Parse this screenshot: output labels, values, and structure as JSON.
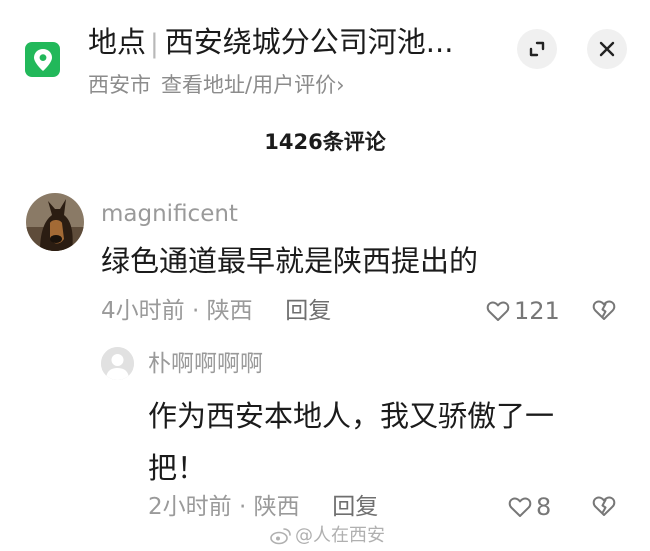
{
  "header": {
    "place_label": "地点",
    "place_name": "西安绕城分公司河池...",
    "city": "西安市",
    "address_link": "查看地址/用户评价",
    "chevron": "›"
  },
  "comment_count": "1426条评论",
  "comments": [
    {
      "username": "magnificent",
      "text": "绿色通道最早就是陕西提出的",
      "time": "4小时前",
      "dot": "·",
      "region": "陕西",
      "reply_label": "回复",
      "likes": "121"
    },
    {
      "username": "朴啊啊啊啊",
      "text": "作为西安本地人，我又骄傲了一把！",
      "time": "2小时前",
      "dot": "·",
      "region": "陕西",
      "reply_label": "回复",
      "likes": "8"
    }
  ],
  "watermark": "@人在西安",
  "colors": {
    "location_icon_bg": "#22b85a",
    "muted_text": "#9a9a9a",
    "button_bg": "#f0f0f0"
  },
  "icons": [
    "location-pin-icon",
    "expand-icon",
    "close-icon",
    "heart-icon",
    "dislike-icon",
    "weibo-logo-icon"
  ]
}
